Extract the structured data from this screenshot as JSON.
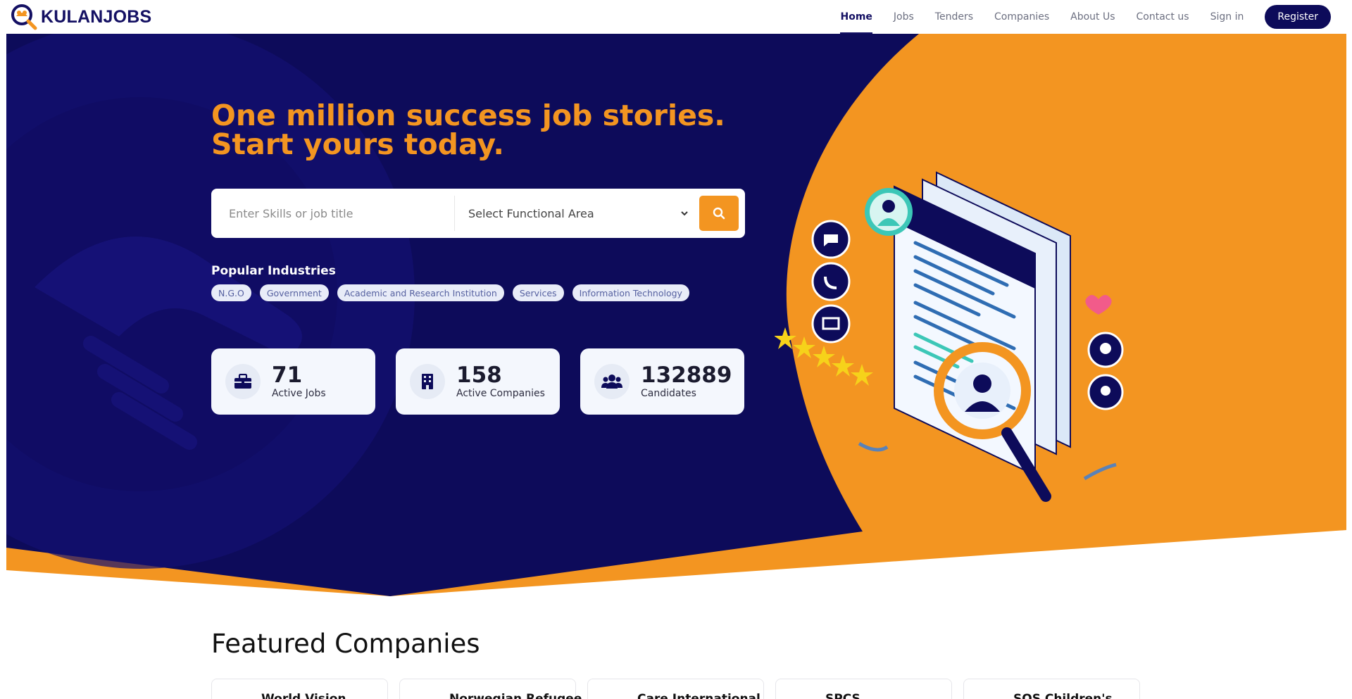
{
  "brand": {
    "name": "KULANJOBS"
  },
  "nav": {
    "items": [
      {
        "label": "Home",
        "active": true
      },
      {
        "label": "Jobs"
      },
      {
        "label": "Tenders"
      },
      {
        "label": "Companies"
      },
      {
        "label": "About Us"
      },
      {
        "label": "Contact us"
      },
      {
        "label": "Sign in"
      }
    ],
    "register_label": "Register"
  },
  "hero": {
    "title_line1": "One million success job stories.",
    "title_line2": "Start yours today.",
    "search": {
      "placeholder": "Enter Skills or job title",
      "select_value": "Select Functional Area"
    },
    "popular_title": "Popular Industries",
    "industries": [
      "N.G.O",
      "Government",
      "Academic and Research Institution",
      "Services",
      "Information Technology"
    ],
    "stats": [
      {
        "value": "71",
        "label": "Active Jobs",
        "icon": "briefcase-icon"
      },
      {
        "value": "158",
        "label": "Active Companies",
        "icon": "building-icon"
      },
      {
        "value": "132889",
        "label": "Candidates",
        "icon": "users-icon"
      }
    ]
  },
  "featured": {
    "title": "Featured Companies",
    "companies": [
      {
        "name": "World Vision"
      },
      {
        "name": "Norwegian Refugee"
      },
      {
        "name": "Care International"
      },
      {
        "name": "SPCS"
      },
      {
        "name": "SOS Children's"
      }
    ]
  },
  "colors": {
    "navy": "#0d0b5a",
    "orange": "#f39521",
    "chip_bg": "#e8ecf8"
  }
}
